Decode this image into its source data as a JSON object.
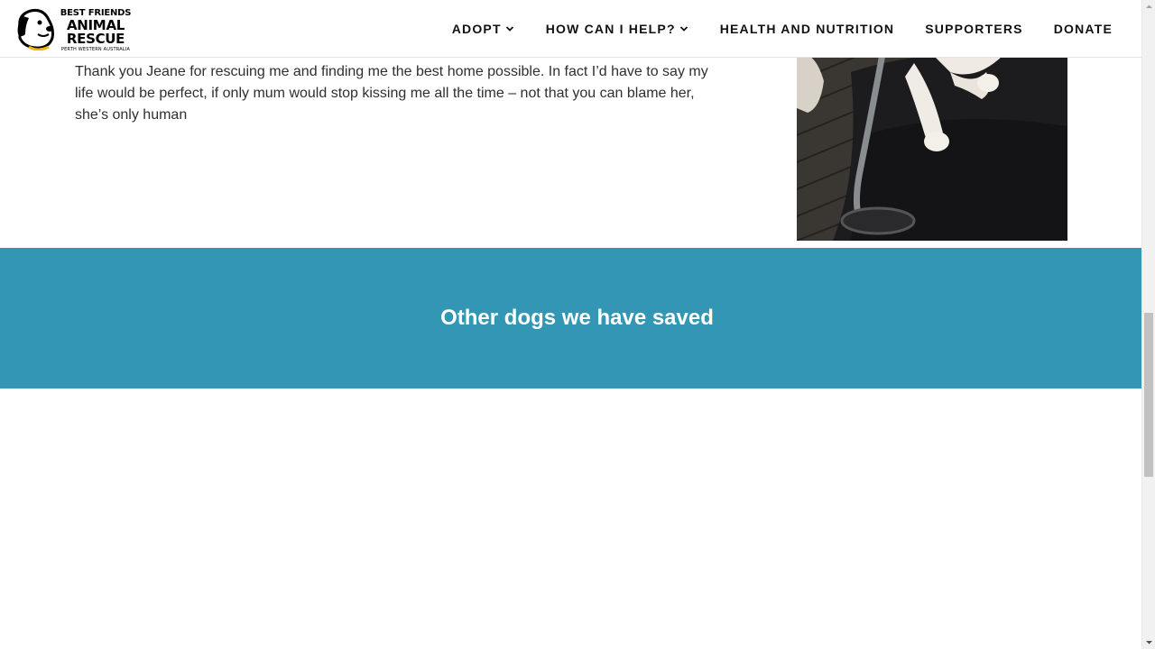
{
  "header": {
    "logo": {
      "line1": "BEST FRIENDS",
      "line2": "ANIMAL",
      "line3": "RESCUE",
      "line4": "PERTH WESTERN AUSTRALIA"
    },
    "nav": [
      {
        "label": "ADOPT",
        "has_dropdown": true
      },
      {
        "label": "HOW CAN I HELP?",
        "has_dropdown": true
      },
      {
        "label": "HEALTH AND NUTRITION",
        "has_dropdown": false
      },
      {
        "label": "SUPPORTERS",
        "has_dropdown": false
      },
      {
        "label": "DONATE",
        "has_dropdown": false
      }
    ]
  },
  "story": {
    "text": "Thank you Jeane for rescuing me and finding me the best home possible. In fact I’d have to say my life would be perfect, if only mum would stop kissing me all the time – not that you can blame her, she’s only human",
    "photo_icon": "dog-in-wheelchair-photo"
  },
  "saved_section": {
    "title": "Other dogs we have saved"
  },
  "colors": {
    "band": "#3396b4",
    "header_bg": "#ffffff",
    "text": "#2f2f2f"
  }
}
